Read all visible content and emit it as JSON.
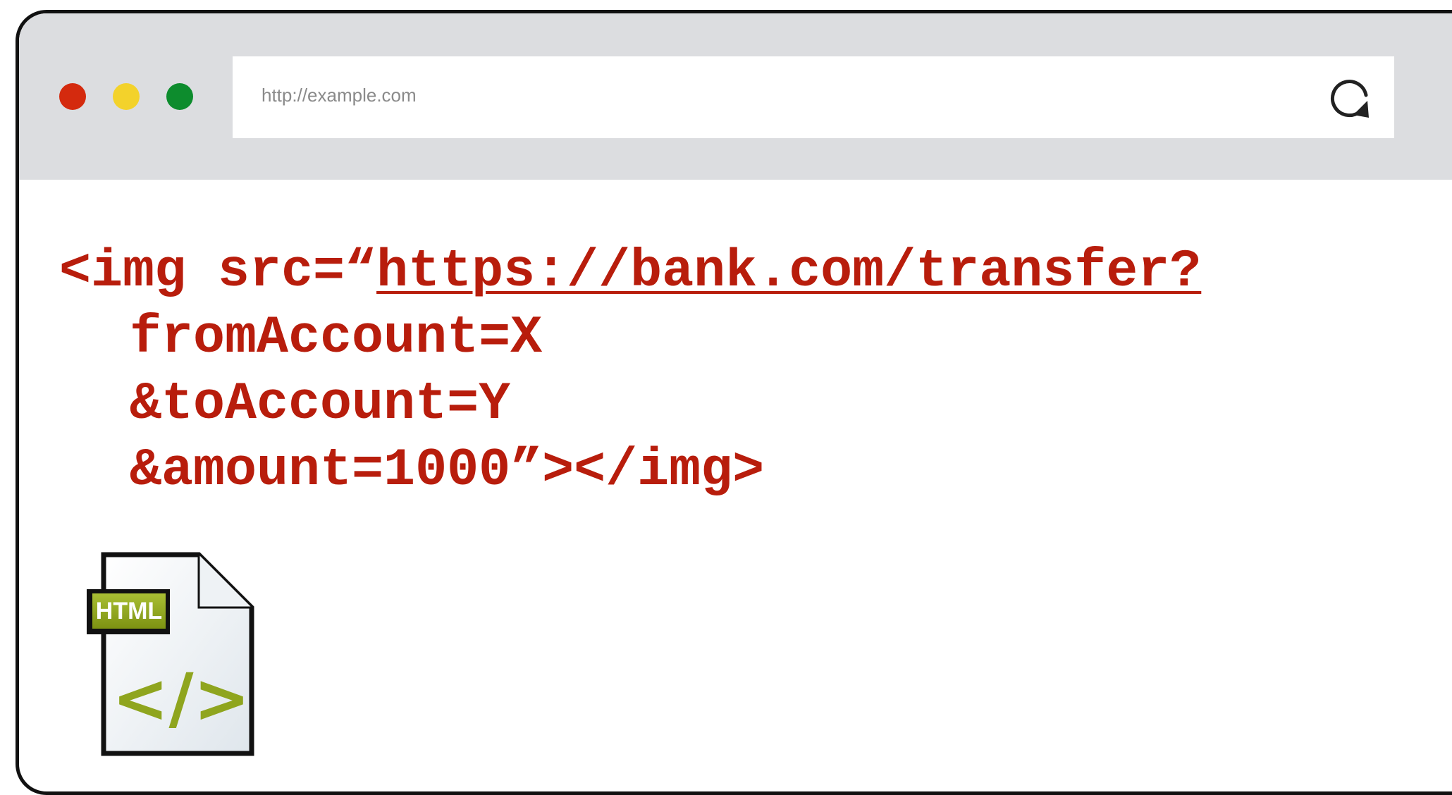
{
  "browser": {
    "traffic_lights": [
      {
        "name": "close",
        "color": "#d42a0e"
      },
      {
        "name": "minimize",
        "color": "#f3d22b"
      },
      {
        "name": "zoom",
        "color": "#0d8c2d"
      }
    ],
    "address_bar": {
      "url": "http://example.com"
    },
    "reload_icon": "reload-icon"
  },
  "content": {
    "code_color": "#b81d0c",
    "line1_prefix": "<img src=“",
    "line1_link": "https://bank.com/transfer?",
    "line2": "fromAccount=X",
    "line3": "&toAccount=Y",
    "line4": "&amount=1000”></img>"
  },
  "file_icon": {
    "badge_label": "HTML",
    "glyph": "</>",
    "accent_color": "#8fa51e"
  }
}
